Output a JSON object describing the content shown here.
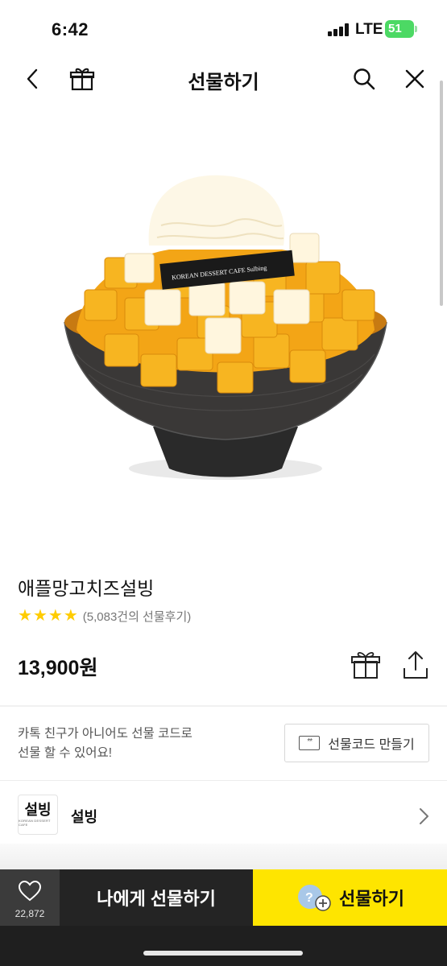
{
  "status": {
    "time": "6:42",
    "network": "LTE",
    "battery": "51"
  },
  "nav": {
    "title": "선물하기"
  },
  "product": {
    "image_brand_text": "KOREAN DESSERT CAFE Sulbing",
    "name": "애플망고치즈설빙",
    "rating_stars": 4,
    "review_text": "(5,083건의 선물후기)",
    "price": "13,900원"
  },
  "giftcode": {
    "line1": "카톡 친구가 아니어도 선물 코드로",
    "line2": "선물 할 수 있어요!",
    "button_label": "선물코드 만들기",
    "ticket_glyph": "**"
  },
  "brand": {
    "logo_text": "설빙",
    "logo_sub": "KOREAN DESSERT CAFE",
    "name": "설빙"
  },
  "bottom": {
    "like_count": "22,872",
    "self_gift_label": "나에게 선물하기",
    "gift_label": "선물하기"
  },
  "colors": {
    "accent_yellow": "#fee500",
    "star": "#ffcc00",
    "dark_bar": "#1f1f1f"
  }
}
